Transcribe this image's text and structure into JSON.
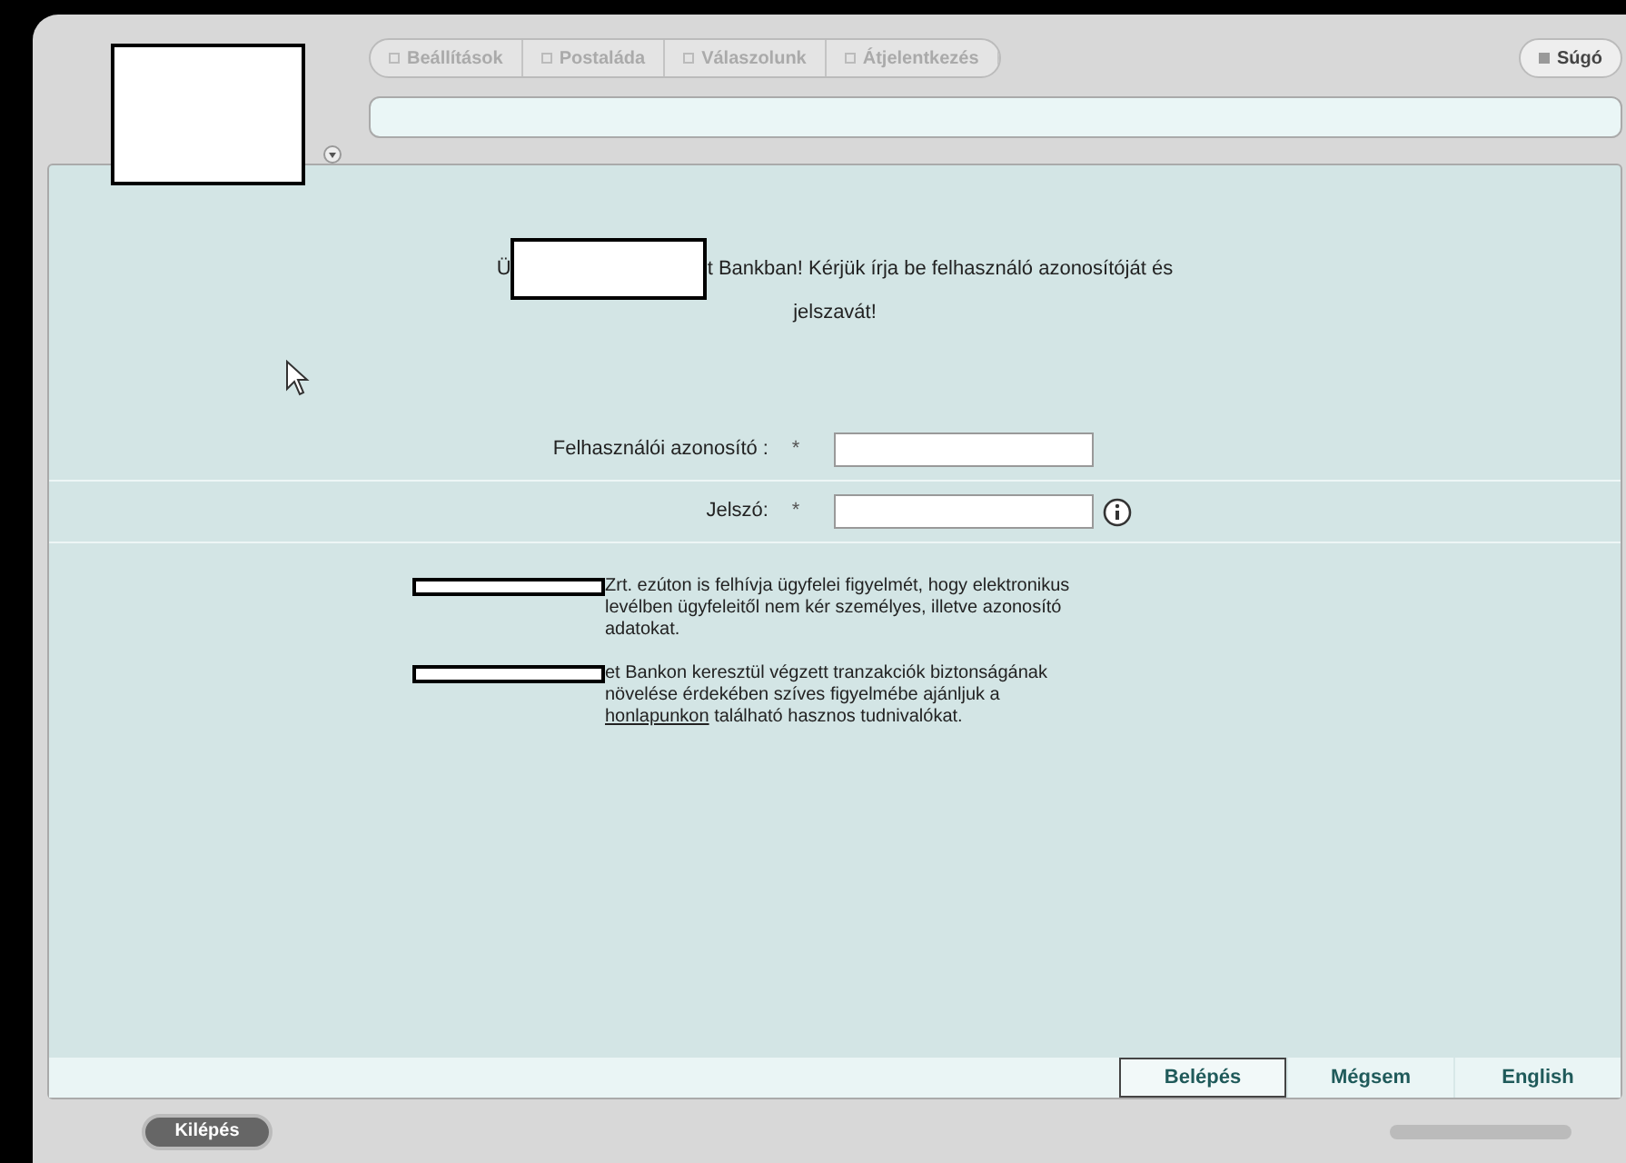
{
  "tabs": [
    {
      "label": "Beállítások"
    },
    {
      "label": "Postaláda"
    },
    {
      "label": "Válaszolunk"
    },
    {
      "label": "Átjelentkezés"
    }
  ],
  "help_button": "Súgó",
  "greeting": {
    "before": "Ü",
    "after": "t Bankban! Kérjük írja be felhasználó azonosítóját és jelszavát!"
  },
  "fields": [
    {
      "label": "Felhasználói azonosító :",
      "required_mark": "*",
      "info": false
    },
    {
      "label": "Jelszó:",
      "required_mark": "*",
      "info": true
    }
  ],
  "notices": [
    {
      "text": "Zrt. ezúton is felhívja ügyfelei figyelmét, hogy elektronikus levélben ügyfeleitől nem kér személyes, illetve azonosító adatokat."
    },
    {
      "text": "et Bankon keresztül végzett tranzakciók biztonságának növelése érdekében szíves figyelmébe ajánljuk a",
      "link": "honlapunkon",
      "after": "található hasznos tudnivalókat."
    }
  ],
  "actions": [
    {
      "label": "Belépés",
      "selected": true
    },
    {
      "label": "Mégsem",
      "selected": false
    },
    {
      "label": "English",
      "selected": false
    }
  ],
  "exit_button": "Kilépés"
}
